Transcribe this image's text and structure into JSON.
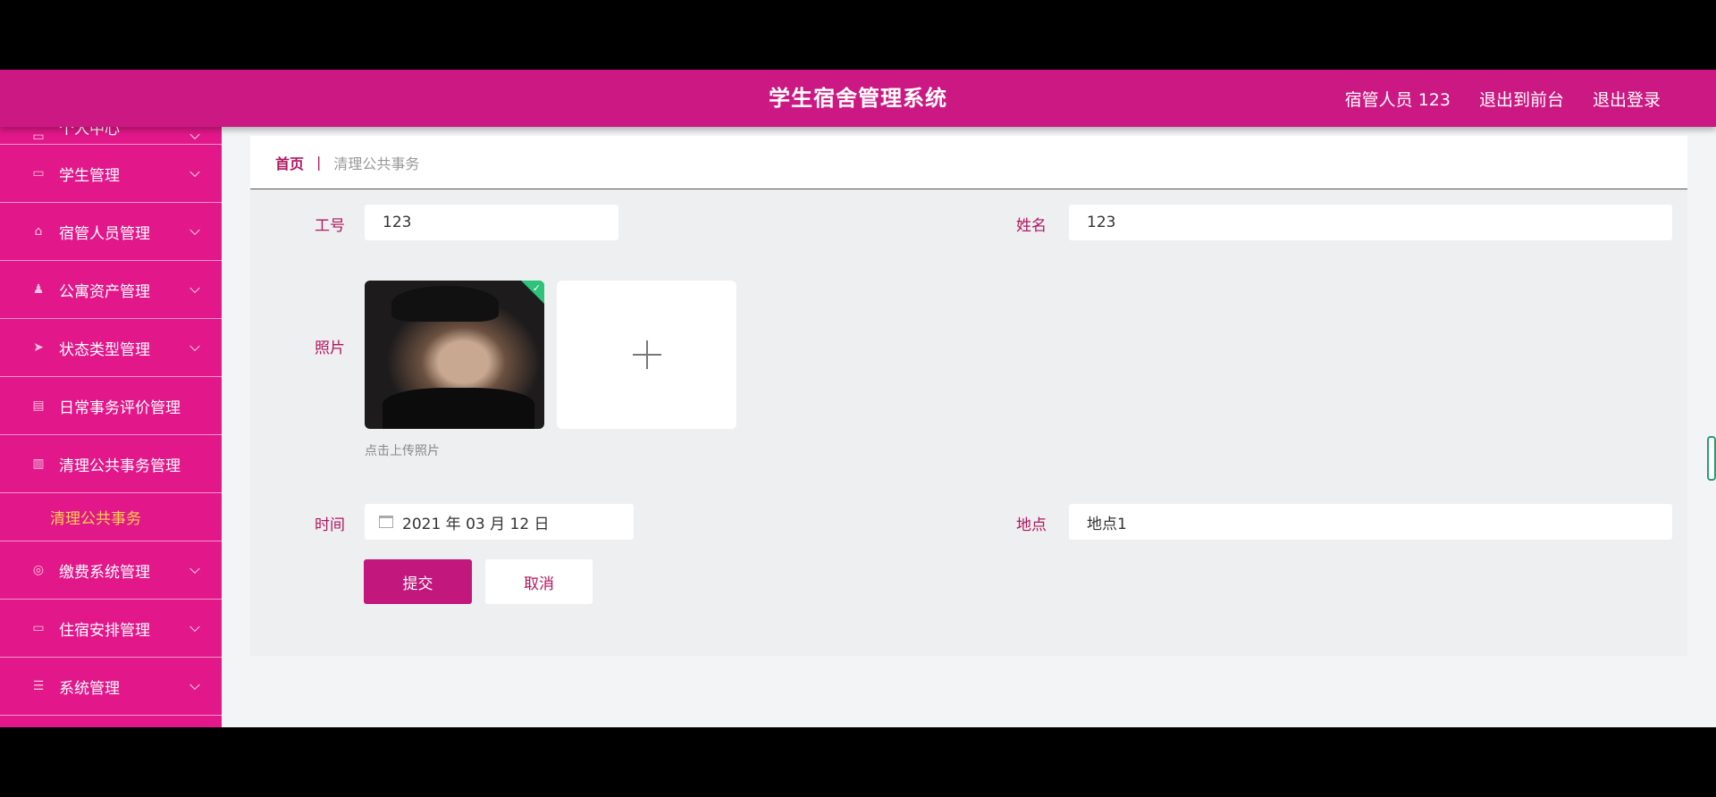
{
  "header": {
    "title": "学生宿舍管理系统",
    "user_label": "宿管人员 123",
    "back_to_front": "退出到前台",
    "logout": "退出登录"
  },
  "sidebar": {
    "items": [
      {
        "label": "个人中心",
        "icon": "user-icon"
      },
      {
        "label": "学生管理",
        "icon": "monitor-icon"
      },
      {
        "label": "宿管人员管理",
        "icon": "house-icon"
      },
      {
        "label": "公寓资产管理",
        "icon": "person-icon"
      },
      {
        "label": "状态类型管理",
        "icon": "send-icon"
      },
      {
        "label": "日常事务评价管理",
        "icon": "printer-icon"
      },
      {
        "label": "清理公共事务管理",
        "icon": "chart-icon"
      }
    ],
    "active_sub": "清理公共事务",
    "items_after": [
      {
        "label": "缴费系统管理",
        "icon": "circle-icon"
      },
      {
        "label": "住宿安排管理",
        "icon": "window-icon"
      },
      {
        "label": "系统管理",
        "icon": "list-icon"
      }
    ]
  },
  "breadcrumb": {
    "home": "首页",
    "separator": "|",
    "current": "清理公共事务"
  },
  "form": {
    "work_id_label": "工号",
    "work_id_value": "123",
    "name_label": "姓名",
    "name_value": "123",
    "photo_label": "照片",
    "upload_hint": "点击上传照片",
    "time_label": "时间",
    "time_value": "2021 年 03 月 12 日",
    "place_label": "地点",
    "place_value": "地点1",
    "submit": "提交",
    "cancel": "取消"
  },
  "colors": {
    "header": "#cc1882",
    "sidebar": "#e2178a",
    "accent": "#b0165f",
    "active_sub": "#f7d34a"
  }
}
